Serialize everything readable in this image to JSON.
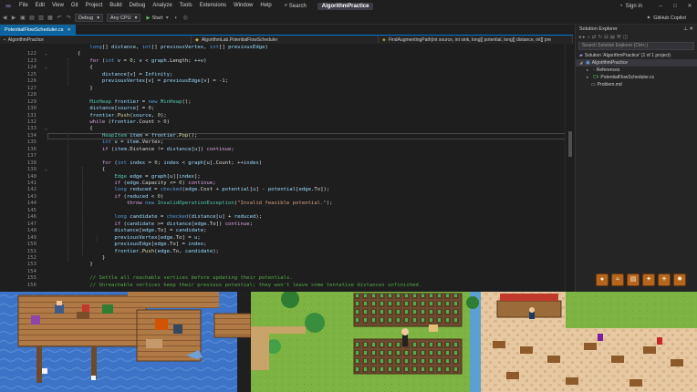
{
  "menubar": {
    "items": [
      "File",
      "Edit",
      "View",
      "Git",
      "Project",
      "Build",
      "Debug",
      "Analyze",
      "Tools",
      "Extensions",
      "Window",
      "Help"
    ],
    "search_label": "Search",
    "solution_name": "AlgorithmPractice",
    "sign_in": "Sign in"
  },
  "toolbar": {
    "config": "Debug",
    "platform": "Any CPU",
    "start_label": "Start",
    "copilot_label": "GitHub Copilot"
  },
  "editor": {
    "tab_label": "PotentialFlowScheduler.cs",
    "nav": [
      "AlgorithmPractice",
      "AlgorithmLab.PotentialFlowScheduler",
      "FindAugmentingPath(int source, int sink, long[] potential, long[] distance, int[] pre"
    ]
  },
  "code_lines": [
    {
      "n": "",
      "html": "            <span class='k'>long</span>[] <span class='v'>distance</span>, <span class='k'>int</span>[] <span class='v'>previousVertex</span>, <span class='k'>int</span>[] <span class='v'>previousEdge</span>)"
    },
    {
      "n": "122",
      "html": "        {"
    },
    {
      "n": "123",
      "html": "            <span class='kc'>for</span> (<span class='k'>int</span> <span class='v'>v</span> = <span class='n'>0</span>; <span class='v'>v</span> &lt; <span class='v'>graph</span>.Length; ++<span class='v'>v</span>)"
    },
    {
      "n": "124",
      "html": "            {"
    },
    {
      "n": "125",
      "html": "                <span class='v'>distance</span>[<span class='v'>v</span>] = <span class='v'>Infinity</span>;"
    },
    {
      "n": "126",
      "html": "                <span class='v'>previousVertex</span>[<span class='v'>v</span>] = <span class='v'>previousEdge</span>[<span class='v'>v</span>] = -<span class='n'>1</span>;"
    },
    {
      "n": "127",
      "html": "            }"
    },
    {
      "n": "128",
      "html": ""
    },
    {
      "n": "129",
      "html": "            <span class='t'>MinHeap</span> <span class='v'>frontier</span> = <span class='k'>new</span> <span class='t'>MinHeap</span>();"
    },
    {
      "n": "130",
      "html": "            <span class='v'>distance</span>[<span class='v'>source</span>] = <span class='n'>0</span>;"
    },
    {
      "n": "131",
      "html": "            <span class='v'>frontier</span>.<span class='m'>Push</span>(<span class='v'>source</span>, <span class='n'>0</span>);"
    },
    {
      "n": "132",
      "html": "            <span class='kc'>while</span> (<span class='v'>frontier</span>.Count &gt; <span class='n'>0</span>)"
    },
    {
      "n": "133",
      "html": "            {"
    },
    {
      "n": "134",
      "html": "                <span class='t'>HeapItem</span> <span class='v'>item</span> = <span class='v'>frontier</span>.<span class='m'>Pop</span>();"
    },
    {
      "n": "135",
      "html": "                <span class='k'>int</span> <span class='v'>u</span> = <span class='v'>item</span>.Vertex;"
    },
    {
      "n": "136",
      "html": "                <span class='kc'>if</span> (<span class='v'>item</span>.Distance != <span class='v'>distance</span>[<span class='v'>u</span>]) <span class='kc'>continue</span>;"
    },
    {
      "n": "137",
      "html": ""
    },
    {
      "n": "138",
      "html": "                <span class='kc'>for</span> (<span class='k'>int</span> <span class='v'>index</span> = <span class='n'>0</span>; <span class='v'>index</span> &lt; <span class='v'>graph</span>[<span class='v'>u</span>].Count; ++<span class='v'>index</span>)"
    },
    {
      "n": "139",
      "html": "                {"
    },
    {
      "n": "140",
      "html": "                    <span class='t'>Edge</span> <span class='v'>edge</span> = <span class='v'>graph</span>[<span class='v'>u</span>][<span class='v'>index</span>];"
    },
    {
      "n": "141",
      "html": "                    <span class='kc'>if</span> (<span class='v'>edge</span>.Capacity &lt;= <span class='n'>0</span>) <span class='kc'>continue</span>;"
    },
    {
      "n": "142",
      "html": "                    <span class='k'>long</span> <span class='v'>reduced</span> = <span class='k'>checked</span>(<span class='v'>edge</span>.Cost + <span class='v'>potential</span>[<span class='v'>u</span>] - <span class='v'>potential</span>[<span class='v'>edge</span>.To]);"
    },
    {
      "n": "143",
      "html": "                    <span class='kc'>if</span> (<span class='v'>reduced</span> &lt; <span class='n'>0</span>)"
    },
    {
      "n": "144",
      "html": "                        <span class='kc'>throw</span> <span class='k'>new</span> <span class='t'>InvalidOperationException</span>(<span class='s'>\"Invalid feasible potential.\"</span>);"
    },
    {
      "n": "145",
      "html": ""
    },
    {
      "n": "146",
      "html": "                    <span class='k'>long</span> <span class='v'>candidate</span> = <span class='k'>checked</span>(<span class='v'>distance</span>[<span class='v'>u</span>] + <span class='v'>reduced</span>);"
    },
    {
      "n": "147",
      "html": "                    <span class='kc'>if</span> (<span class='v'>candidate</span> &gt;= <span class='v'>distance</span>[<span class='v'>edge</span>.To]) <span class='kc'>continue</span>;"
    },
    {
      "n": "148",
      "html": "                    <span class='v'>distance</span>[<span class='v'>edge</span>.To] = <span class='v'>candidate</span>;"
    },
    {
      "n": "149",
      "html": "                    <span class='v'>previousVertex</span>[<span class='v'>edge</span>.To] = <span class='v'>u</span>;"
    },
    {
      "n": "150",
      "html": "                    <span class='v'>previousEdge</span>[<span class='v'>edge</span>.To] = <span class='v'>index</span>;"
    },
    {
      "n": "151",
      "html": "                    <span class='v'>frontier</span>.<span class='m'>Push</span>(<span class='v'>edge</span>.To, <span class='v'>candidate</span>);"
    },
    {
      "n": "152",
      "html": "                }"
    },
    {
      "n": "153",
      "html": "            }"
    },
    {
      "n": "154",
      "html": ""
    },
    {
      "n": "155",
      "html": "            <span class='c'>// Settle all reachable vertices before updating their potentials.</span>"
    },
    {
      "n": "156",
      "html": "            <span class='c'>// Unreachable vertices keep their previous potential; they won't leave some tentative distances unfinished.</span>"
    }
  ],
  "solution_explorer": {
    "title": "Solution Explorer",
    "search_placeholder": "Search Solution Explorer (Ctrl+;)",
    "solution_label": "Solution 'AlgorithmPractice' (1 of 1 project)",
    "project_label": "AlgorithmPractice",
    "references_label": "References",
    "file1": "PotentialFlowScheduler.cs",
    "file2": "Problem.md"
  }
}
